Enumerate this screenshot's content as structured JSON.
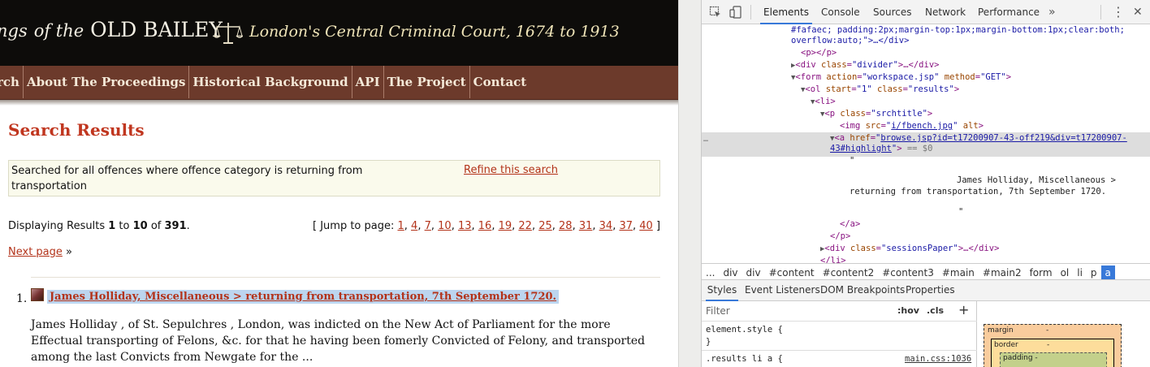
{
  "site": {
    "title_prefix": "ngs",
    "title_of_the": "of the",
    "title_name": "OLD BAILEY",
    "tagline": "London's Central Criminal Court, 1674 to 1913"
  },
  "nav": {
    "items": [
      "rch",
      "About The Proceedings",
      "Historical Background",
      "API",
      "The Project",
      "Contact"
    ]
  },
  "results": {
    "heading": "Search Results",
    "search_description": "Searched for all offences where offence category is returning from transportation",
    "refine_label": "Refine this search",
    "displaying_prefix": "Displaying Results ",
    "range_start": "1",
    "range_to": " to ",
    "range_end": "10",
    "range_of": " of ",
    "total": "391",
    "range_suffix": ".",
    "jump_prefix": "[ Jump to page: ",
    "jump_suffix": " ]",
    "jump_pages": [
      "1",
      "4",
      "7",
      "10",
      "13",
      "16",
      "19",
      "22",
      "25",
      "28",
      "31",
      "34",
      "37",
      "40"
    ],
    "next_page_label": "Next page",
    "next_page_suffix": " »",
    "items": [
      {
        "number": "1.",
        "title": "James Holliday, Miscellaneous > returning from transportation, 7th September 1720.",
        "snippet": "James Holliday , of St. Sepulchres , London, was indicted on the New Act of Parliament for the more Effectual transporting of Felons, &c. for that he having been fomerly Convicted of Felony, and transported among the last Convicts from Newgate for the ..."
      }
    ]
  },
  "devtools": {
    "tabs": [
      "Elements",
      "Console",
      "Sources",
      "Network",
      "Performance"
    ],
    "active_tab": "Elements",
    "more_label": "»",
    "menu_label": "⋮",
    "close_label": "✕",
    "dom": {
      "l1": "#fafaec; padding:2px;margin-top:1px;margin-bottom:1px;clear:both;",
      "l2": "overflow:auto;\">…</div>",
      "p_tag": "<p></p>",
      "divider_class": "divider",
      "form_action": "workspace.jsp",
      "form_method": "GET",
      "ol_start": "1",
      "ol_class": "results",
      "li_tag": "<li>",
      "p_class": "srchtitle",
      "img_src": "i/fbench.jpg",
      "img_alt": "alt",
      "a_href_1": "browse.jsp?id=t17200907-43-off219&div=t17200907-",
      "a_href_2": "43#highlight",
      "dollar_zero": "== $0",
      "quote": "\"",
      "text_1": "James Holliday, Miscellaneous >",
      "text_2": "returning from transportation, 7th September 1720.",
      "a_close": "</a>",
      "p_close": "</p>",
      "sessions_class": "sessionsPaper",
      "li_close": "</li>",
      "dots": "…"
    },
    "breadcrumbs": [
      "...",
      "div",
      "div",
      "#content",
      "#content2",
      "#content3",
      "#main",
      "#main2",
      "form",
      "ol",
      "li",
      "p",
      "a"
    ],
    "active_crumb": "a",
    "sub_tabs": [
      "Styles",
      "Event Listeners",
      "DOM Breakpoints",
      "Properties"
    ],
    "active_sub_tab": "Styles",
    "filter_placeholder": "Filter",
    "hov_label": ":hov",
    "cls_label": ".cls",
    "plus_label": "+",
    "css": {
      "element_style": "element.style {",
      "close_brace": "}",
      "rule_selector": ".results li a {",
      "rule_source": "main.css:1036"
    },
    "box_model": {
      "margin_label": "margin",
      "margin_value": "-",
      "border_label": "border",
      "border_value": "-",
      "padding_label": "padding -"
    }
  },
  "colors": {
    "link": "#b3331a",
    "nav_bg": "#6c3a2b",
    "heading": "#c0361f",
    "devtools_accent": "#3879d9"
  }
}
